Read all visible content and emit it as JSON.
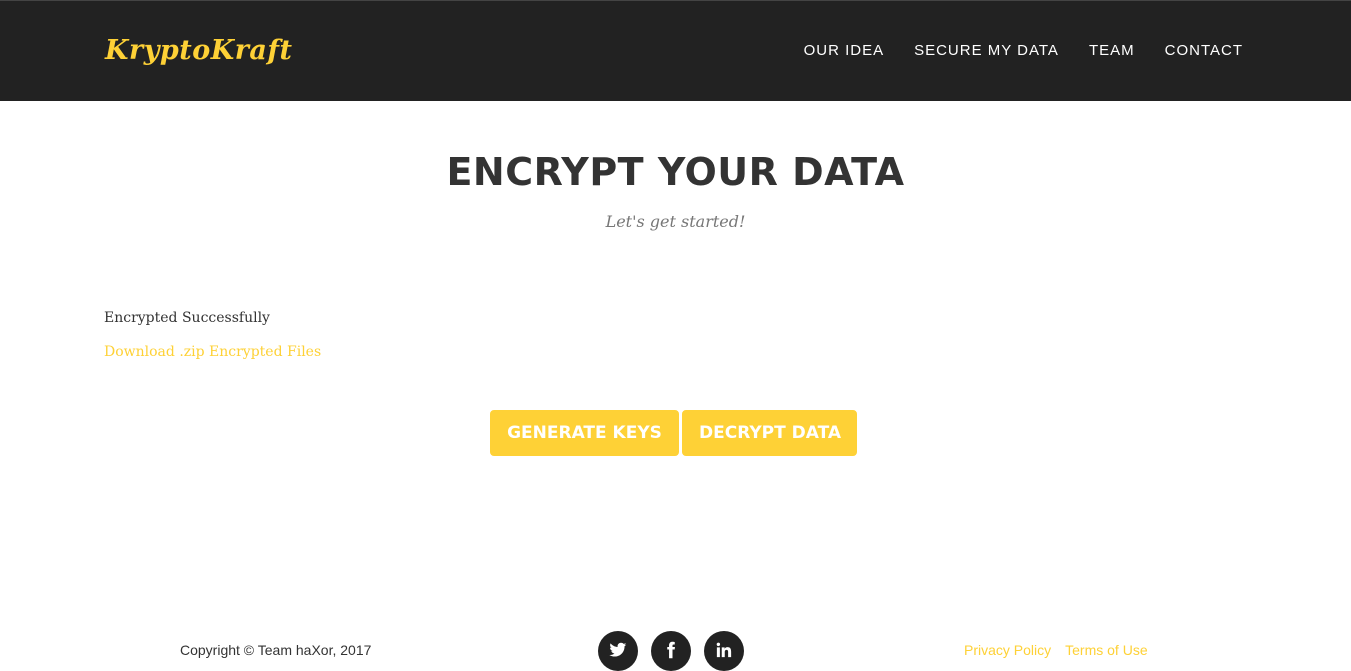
{
  "colors": {
    "brand": "#fed136",
    "navbar_bg": "#222222",
    "text": "#333333",
    "muted": "#777777"
  },
  "navbar": {
    "brand": "KryptoKraft",
    "items": [
      {
        "label": "OUR IDEA"
      },
      {
        "label": "SECURE MY DATA"
      },
      {
        "label": "TEAM"
      },
      {
        "label": "CONTACT"
      }
    ]
  },
  "main": {
    "heading": "ENCRYPT YOUR DATA",
    "subheading": "Let's get started!",
    "status": "Encrypted Successfully",
    "download_link": "Download .zip Encrypted Files",
    "buttons": {
      "generate": "GENERATE KEYS",
      "decrypt": "DECRYPT DATA"
    }
  },
  "footer": {
    "copyright": "Copyright © Team haXor, 2017",
    "social": [
      {
        "icon": "twitter-icon"
      },
      {
        "icon": "facebook-icon"
      },
      {
        "icon": "linkedin-icon"
      }
    ],
    "links": {
      "privacy": "Privacy Policy",
      "terms": "Terms of Use"
    }
  }
}
